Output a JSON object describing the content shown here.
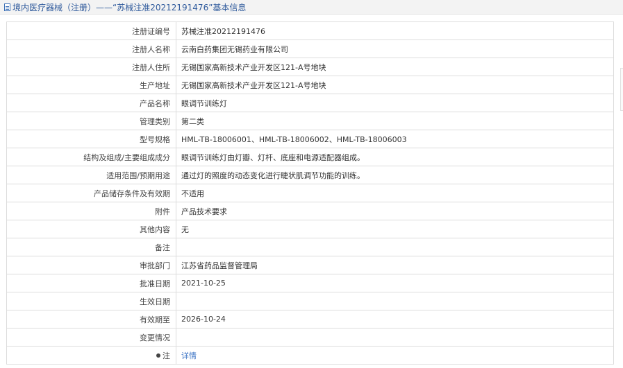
{
  "header": {
    "title": "境内医疗器械（注册）——“苏械注准20212191476”基本信息"
  },
  "rows": [
    {
      "label": "注册证编号",
      "value": "苏械注准20212191476"
    },
    {
      "label": "注册人名称",
      "value": "云南白药集团无锡药业有限公司"
    },
    {
      "label": "注册人住所",
      "value": "无锡国家高新技术产业开发区121-A号地块"
    },
    {
      "label": "生产地址",
      "value": "无锡国家高新技术产业开发区121-A号地块"
    },
    {
      "label": "产品名称",
      "value": "眼调节训练灯"
    },
    {
      "label": "管理类别",
      "value": "第二类"
    },
    {
      "label": "型号规格",
      "value": "HML-TB-18006001、HML-TB-18006002、HML-TB-18006003"
    },
    {
      "label": "结构及组成/主要组成成分",
      "value": "眼调节训练灯由灯瓣、灯杆、底座和电源适配器组成。"
    },
    {
      "label": "适用范围/预期用途",
      "value": "通过灯的照度的动态变化进行睫状肌调节功能的训练。"
    },
    {
      "label": "产品储存条件及有效期",
      "value": "不适用"
    },
    {
      "label": "附件",
      "value": "产品技术要求"
    },
    {
      "label": "其他内容",
      "value": "无"
    },
    {
      "label": "备注",
      "value": ""
    },
    {
      "label": "审批部门",
      "value": "江苏省药品监督管理局"
    },
    {
      "label": "批准日期",
      "value": "2021-10-25"
    },
    {
      "label": "生效日期",
      "value": ""
    },
    {
      "label": "有效期至",
      "value": "2026-10-24"
    },
    {
      "label": "变更情况",
      "value": ""
    },
    {
      "label": "注",
      "value": "详情"
    }
  ]
}
